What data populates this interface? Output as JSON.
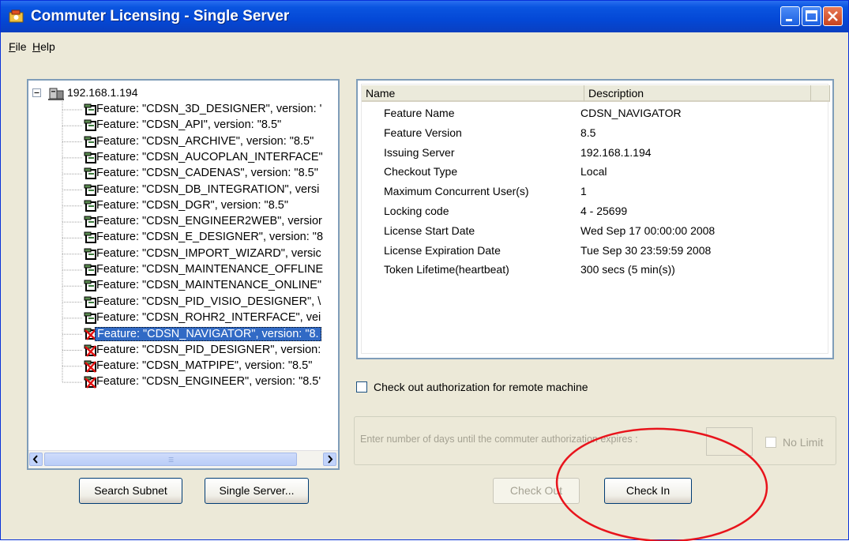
{
  "window": {
    "title": "Commuter Licensing - Single Server"
  },
  "menu": {
    "file": {
      "accel": "F",
      "rest": "ile"
    },
    "help": {
      "accel": "H",
      "rest": "elp"
    }
  },
  "tree": {
    "root": "192.168.1.194",
    "items": [
      {
        "label": "Feature: \"CDSN_3D_DESIGNER\", version: '",
        "icon": "license-feature-icon"
      },
      {
        "label": "Feature: \"CDSN_API\", version: \"8.5\"",
        "icon": "license-feature-icon"
      },
      {
        "label": "Feature: \"CDSN_ARCHIVE\", version: \"8.5\"",
        "icon": "license-feature-icon"
      },
      {
        "label": "Feature: \"CDSN_AUCOPLAN_INTERFACE\"",
        "icon": "license-feature-icon"
      },
      {
        "label": "Feature: \"CDSN_CADENAS\", version: \"8.5\"",
        "icon": "license-feature-icon"
      },
      {
        "label": "Feature: \"CDSN_DB_INTEGRATION\", versi",
        "icon": "license-feature-icon"
      },
      {
        "label": "Feature: \"CDSN_DGR\", version: \"8.5\"",
        "icon": "license-feature-icon"
      },
      {
        "label": "Feature: \"CDSN_ENGINEER2WEB\", versior",
        "icon": "license-feature-icon"
      },
      {
        "label": "Feature: \"CDSN_E_DESIGNER\", version: \"8",
        "icon": "license-feature-icon"
      },
      {
        "label": "Feature: \"CDSN_IMPORT_WIZARD\", versic",
        "icon": "license-feature-icon"
      },
      {
        "label": "Feature: \"CDSN_MAINTENANCE_OFFLINE",
        "icon": "license-feature-icon"
      },
      {
        "label": "Feature: \"CDSN_MAINTENANCE_ONLINE\"",
        "icon": "license-feature-icon"
      },
      {
        "label": "Feature: \"CDSN_PID_VISIO_DESIGNER\", \\",
        "icon": "license-feature-icon"
      },
      {
        "label": "Feature: \"CDSN_ROHR2_INTERFACE\", vei",
        "icon": "license-feature-icon"
      },
      {
        "label": "Feature: \"CDSN_NAVIGATOR\", version: \"8.",
        "icon": "checked-out-feature-icon",
        "selected": true
      },
      {
        "label": "Feature: \"CDSN_PID_DESIGNER\", version:",
        "icon": "checked-out-feature-icon"
      },
      {
        "label": "Feature: \"CDSN_MATPIPE\", version: \"8.5\"",
        "icon": "checked-out-feature-icon"
      },
      {
        "label": "Feature: \"CDSN_ENGINEER\", version: \"8.5'",
        "icon": "checked-out-feature-icon"
      }
    ]
  },
  "details": {
    "col_name": "Name",
    "col_description": "Description",
    "rows": [
      {
        "name": "Feature Name",
        "value": "CDSN_NAVIGATOR"
      },
      {
        "name": "Feature Version",
        "value": "8.5"
      },
      {
        "name": "Issuing Server",
        "value": "192.168.1.194"
      },
      {
        "name": "Checkout Type",
        "value": "Local"
      },
      {
        "name": "Maximum Concurrent User(s)",
        "value": "1"
      },
      {
        "name": "Locking code",
        "value": "4 - 25699"
      },
      {
        "name": "License Start Date",
        "value": "Wed Sep 17 00:00:00 2008"
      },
      {
        "name": "License Expiration Date",
        "value": "Tue Sep 30 23:59:59 2008"
      },
      {
        "name": "Token Lifetime(heartbeat)",
        "value": "300 secs (5 min(s))"
      }
    ]
  },
  "remote_checkbox_label": "Check out authorization for remote machine",
  "days_label": "Enter number of days until the commuter authorization expires :",
  "no_limit_label": "No Limit",
  "buttons": {
    "search_subnet": "Search Subnet",
    "single_server": "Single Server...",
    "check_out": "Check Out",
    "check_in": "Check In"
  },
  "colors": {
    "highlight_ellipse": "#e8141c",
    "selection": "#316ac5",
    "title_bar": "#0a55e0"
  }
}
